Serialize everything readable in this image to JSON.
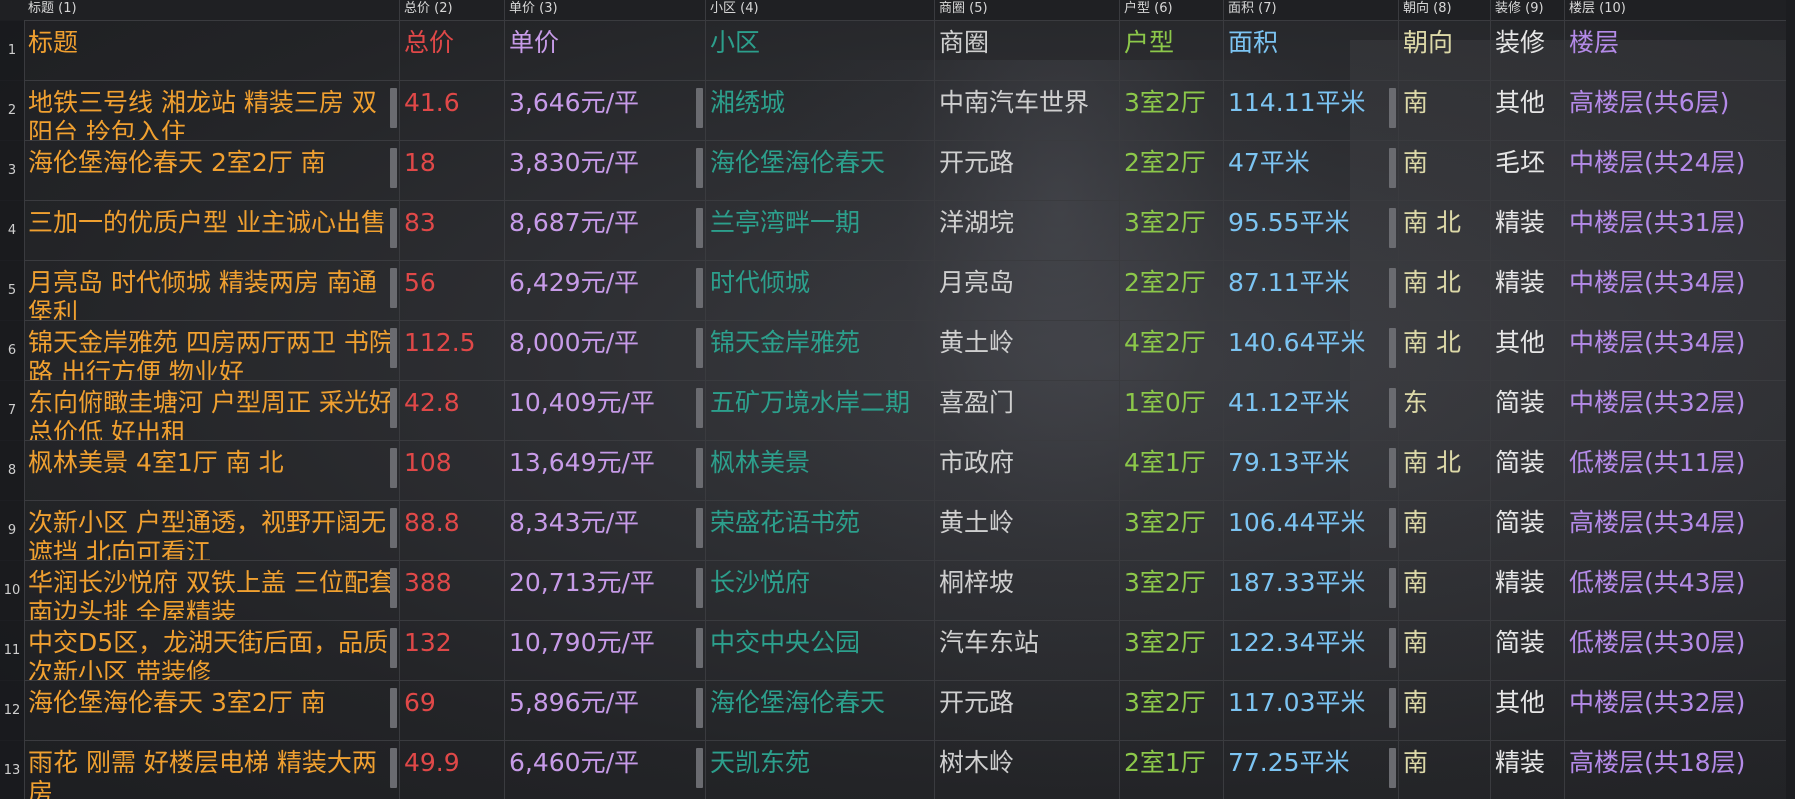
{
  "columns": [
    {
      "header": "标题 (1)",
      "title": "标题"
    },
    {
      "header": "总价 (2)",
      "title": "总价"
    },
    {
      "header": "单价 (3)",
      "title": "单价"
    },
    {
      "header": "小区 (4)",
      "title": "小区"
    },
    {
      "header": "商圈 (5)",
      "title": "商圈"
    },
    {
      "header": "户型 (6)",
      "title": "户型"
    },
    {
      "header": "面积 (7)",
      "title": "面积"
    },
    {
      "header": "朝向 (8)",
      "title": "朝向"
    },
    {
      "header": "装修 (9)",
      "title": "装修"
    },
    {
      "header": "楼层 (10)",
      "title": "楼层"
    }
  ],
  "header_row_number": "1",
  "rows": [
    {
      "n": "2",
      "title": "地铁三号线 湘龙站 精装三房 双阳台 拎包入住",
      "total": "41.6",
      "unit": "3,646元/平",
      "community": "湘绣城",
      "district": "中南汽车世界",
      "layout": "3室2厅",
      "area": "114.11平米",
      "direction": "南",
      "decoration": "其他",
      "floor": "高楼层(共6层)"
    },
    {
      "n": "3",
      "title": "海伦堡海伦春天 2室2厅 南",
      "total": "18",
      "unit": "3,830元/平",
      "community": "海伦堡海伦春天",
      "district": "开元路",
      "layout": "2室2厅",
      "area": "47平米",
      "direction": "南",
      "decoration": "毛坯",
      "floor": "中楼层(共24层)"
    },
    {
      "n": "4",
      "title": "三加一的优质户型 业主诚心出售",
      "total": "83",
      "unit": "8,687元/平",
      "community": "兰亭湾畔一期",
      "district": "洋湖垸",
      "layout": "3室2厅",
      "area": "95.55平米",
      "direction": "南 北",
      "decoration": "精装",
      "floor": "中楼层(共31层)"
    },
    {
      "n": "5",
      "title": "月亮岛 时代倾城 精装两房 南通堡利",
      "total": "56",
      "unit": "6,429元/平",
      "community": "时代倾城",
      "district": "月亮岛",
      "layout": "2室2厅",
      "area": "87.11平米",
      "direction": "南 北",
      "decoration": "精装",
      "floor": "中楼层(共34层)"
    },
    {
      "n": "6",
      "title": "锦天金岸雅苑 四房两厅两卫 书院路 出行方便 物业好",
      "total": "112.5",
      "unit": "8,000元/平",
      "community": "锦天金岸雅苑",
      "district": "黄土岭",
      "layout": "4室2厅",
      "area": "140.64平米",
      "direction": "南 北",
      "decoration": "其他",
      "floor": "中楼层(共34层)"
    },
    {
      "n": "7",
      "title": "东向俯瞰圭塘河 户型周正 采光好 总价低 好出租",
      "total": "42.8",
      "unit": "10,409元/平",
      "community": "五矿万境水岸二期",
      "district": "喜盈门",
      "layout": "1室0厅",
      "area": "41.12平米",
      "direction": "东",
      "decoration": "简装",
      "floor": "中楼层(共32层)"
    },
    {
      "n": "8",
      "title": "枫林美景 4室1厅 南 北",
      "total": "108",
      "unit": "13,649元/平",
      "community": "枫林美景",
      "district": "市政府",
      "layout": "4室1厅",
      "area": "79.13平米",
      "direction": "南 北",
      "decoration": "简装",
      "floor": "低楼层(共11层)"
    },
    {
      "n": "9",
      "title": "次新小区 户型通透，视野开阔无遮挡 北向可看江",
      "total": "88.8",
      "unit": "8,343元/平",
      "community": "荣盛花语书苑",
      "district": "黄土岭",
      "layout": "3室2厅",
      "area": "106.44平米",
      "direction": "南",
      "decoration": "简装",
      "floor": "高楼层(共34层)"
    },
    {
      "n": "10",
      "title": "华润长沙悦府 双铁上盖 三位配套 南边头排 全屋精装",
      "total": "388",
      "unit": "20,713元/平",
      "community": "长沙悦府",
      "district": "桐梓坡",
      "layout": "3室2厅",
      "area": "187.33平米",
      "direction": "南",
      "decoration": "精装",
      "floor": "低楼层(共43层)"
    },
    {
      "n": "11",
      "title": "中交D5区，龙湖天街后面，品质次新小区 带装修",
      "total": "132",
      "unit": "10,790元/平",
      "community": "中交中央公园",
      "district": "汽车东站",
      "layout": "3室2厅",
      "area": "122.34平米",
      "direction": "南",
      "decoration": "简装",
      "floor": "低楼层(共30层)"
    },
    {
      "n": "12",
      "title": "海伦堡海伦春天 3室2厅 南",
      "total": "69",
      "unit": "5,896元/平",
      "community": "海伦堡海伦春天",
      "district": "开元路",
      "layout": "3室2厅",
      "area": "117.03平米",
      "direction": "南",
      "decoration": "其他",
      "floor": "中楼层(共32层)"
    },
    {
      "n": "13",
      "title": "雨花 刚需 好楼层电梯 精装大两房",
      "total": "49.9",
      "unit": "6,460元/平",
      "community": "天凯东苑",
      "district": "树木岭",
      "layout": "2室1厅",
      "area": "77.25平米",
      "direction": "南",
      "decoration": "精装",
      "floor": "高楼层(共18层)"
    }
  ]
}
